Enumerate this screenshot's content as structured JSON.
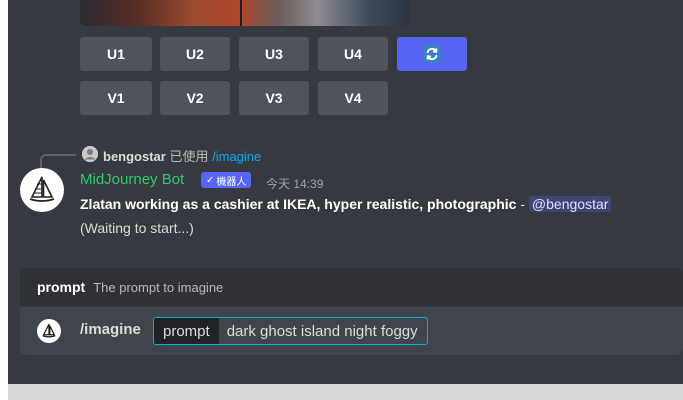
{
  "image_buttons": {
    "upscale": [
      "U1",
      "U2",
      "U3",
      "U4"
    ],
    "variation": [
      "V1",
      "V2",
      "V3",
      "V4"
    ],
    "reroll_icon": "refresh-icon"
  },
  "reply": {
    "username": "bengostar",
    "used_text": "已使用",
    "command": "/imagine"
  },
  "message": {
    "author": "MidJourney Bot",
    "bot_tag": "機器人",
    "timestamp": "今天 14:39",
    "prompt_bold": "Zlatan working as a cashier at IKEA, hyper realistic, photographic",
    "separator": " - ",
    "mention": "@bengostar",
    "status": "(Waiting to start...)"
  },
  "command_options": {
    "option_name": "prompt",
    "option_description": "The prompt to imagine"
  },
  "input": {
    "command": "/imagine",
    "param_label": "prompt",
    "param_value": "dark ghost island night foggy"
  },
  "colors": {
    "background": "#36393f",
    "author": "#2ecc71",
    "link": "#00aff4",
    "bot_tag": "#5865f2",
    "button": "#4f545c",
    "reroll_button": "#5865f2"
  }
}
